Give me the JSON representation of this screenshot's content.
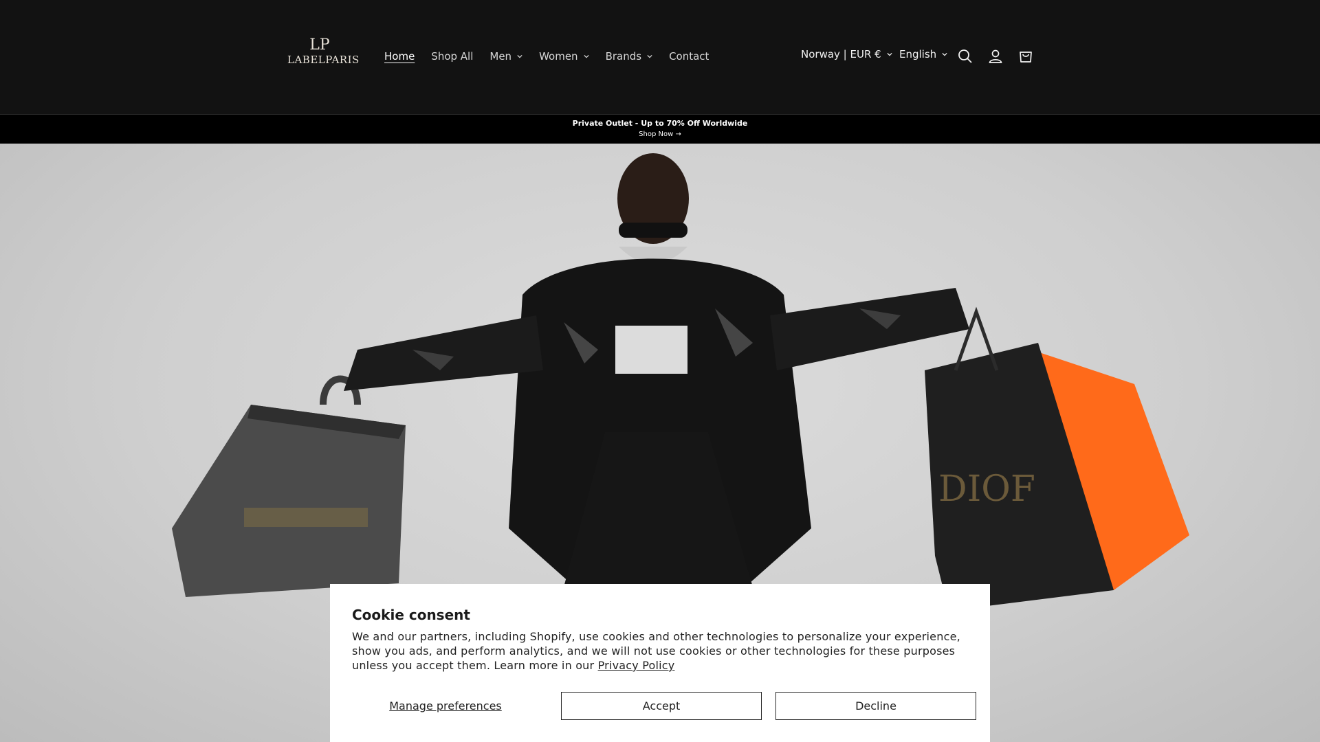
{
  "brand": {
    "monogram": "LP",
    "name": "LABELPARIS"
  },
  "nav": {
    "items": [
      {
        "label": "Home",
        "active": true,
        "dropdown": false
      },
      {
        "label": "Shop All",
        "active": false,
        "dropdown": false
      },
      {
        "label": "Men",
        "active": false,
        "dropdown": true
      },
      {
        "label": "Women",
        "active": false,
        "dropdown": true
      },
      {
        "label": "Brands",
        "active": false,
        "dropdown": true
      },
      {
        "label": "Contact",
        "active": false,
        "dropdown": false
      }
    ]
  },
  "header_tools": {
    "locale": "Norway | EUR €",
    "language": "English",
    "icons": [
      "search-icon",
      "account-icon",
      "cart-icon"
    ]
  },
  "announcement": {
    "text": "Private Outlet - Up to 70% Off Worldwide",
    "link": "Shop Now →"
  },
  "hero": {
    "bag_text": "DIOF"
  },
  "cookie": {
    "title": "Cookie consent",
    "body": "We and our partners, including Shopify, use cookies and other technologies to personalize your experience, show you ads, and perform analytics, and we will not use cookies or other technologies for these purposes unless you accept them. Learn more in our ",
    "policy_link": "Privacy Policy",
    "manage_label": "Manage preferences",
    "accept_label": "Accept",
    "decline_label": "Decline"
  },
  "colors": {
    "header_bg": "#121212",
    "announce_bg": "#000000",
    "hero_bg": "#cfcfcf",
    "accent_orange": "#ff6a1a"
  }
}
